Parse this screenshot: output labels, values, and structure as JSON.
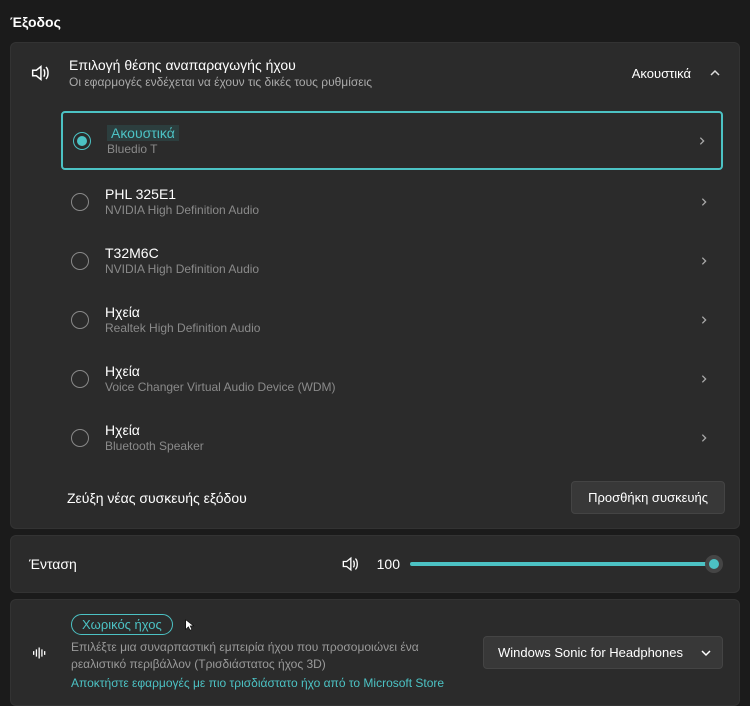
{
  "pageTitle": "Έξοδος",
  "output": {
    "title": "Επιλογή θέσης αναπαραγωγής ήχου",
    "subtitle": "Οι εφαρμογές ενδέχεται να έχουν τις δικές τους ρυθμίσεις",
    "current": "Ακουστικά"
  },
  "devices": [
    {
      "name": "Ακουστικά",
      "sub": "Bluedio T",
      "selected": true
    },
    {
      "name": "PHL 325E1",
      "sub": "NVIDIA High Definition Audio",
      "selected": false
    },
    {
      "name": "T32M6C",
      "sub": "NVIDIA High Definition Audio",
      "selected": false
    },
    {
      "name": "Ηχεία",
      "sub": "Realtek High Definition Audio",
      "selected": false
    },
    {
      "name": "Ηχεία",
      "sub": "Voice Changer Virtual Audio Device (WDM)",
      "selected": false
    },
    {
      "name": "Ηχεία",
      "sub": "Bluetooth Speaker",
      "selected": false
    }
  ],
  "pair": {
    "label": "Ζεύξη νέας συσκευής εξόδου",
    "button": "Προσθήκη συσκευής"
  },
  "volume": {
    "label": "Ένταση",
    "value": "100",
    "percent": 100
  },
  "spatial": {
    "title": "Χωρικός ήχος",
    "sub": "Επιλέξτε μια συναρπαστική εμπειρία ήχου που προσομοιώνει ένα ρεαλιστικό περιβάλλον (Τρισδιάστατος ήχος 3D)",
    "link": "Αποκτήστε εφαρμογές με πιο τρισδιάστατο ήχο από το Microsoft Store",
    "selected": "Windows Sonic for Headphones"
  }
}
